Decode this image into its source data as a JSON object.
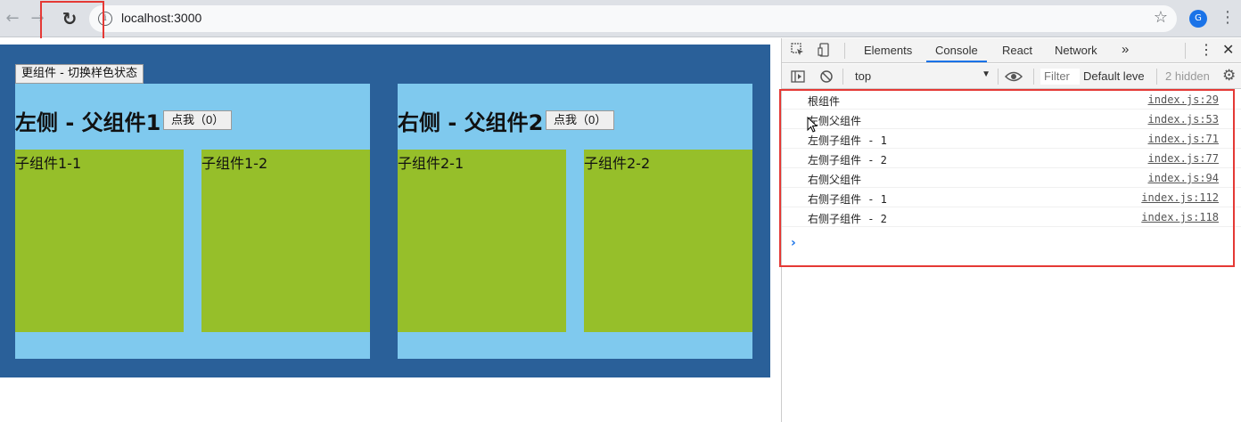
{
  "browser": {
    "url": "localhost:3000",
    "nav_back_icon": "←",
    "nav_forward_icon": "→",
    "reload_icon": "↻",
    "info_icon": "i",
    "star_icon": "☆",
    "profile_initial": "G",
    "menu_icon": "⋮"
  },
  "page": {
    "toggle_button": "更组件 - 切换样色状态",
    "left": {
      "title": "左侧 - 父组件1",
      "button": "点我（0）",
      "children": [
        "子组件1-1",
        "子组件1-2"
      ]
    },
    "right": {
      "title": "右侧 - 父组件2",
      "button": "点我（0）",
      "children": [
        "子组件2-1",
        "子组件2-2"
      ]
    },
    "colors": {
      "root": "#2a6099",
      "parent": "#7fc9ee",
      "child": "#96bf2a"
    }
  },
  "devtools": {
    "tabs": [
      "Elements",
      "Console",
      "React",
      "Network"
    ],
    "active_tab": "Console",
    "more_tabs_icon": "»",
    "context": "top",
    "filter_placeholder": "Filter",
    "levels": "Default leve",
    "hidden": "2 hidden",
    "logs": [
      {
        "msg": "根组件",
        "src": "index.js:29"
      },
      {
        "msg": "左侧父组件",
        "src": "index.js:53"
      },
      {
        "msg": "左侧子组件 - 1",
        "src": "index.js:71"
      },
      {
        "msg": "左侧子组件 - 2",
        "src": "index.js:77"
      },
      {
        "msg": "右侧父组件",
        "src": "index.js:94"
      },
      {
        "msg": "右侧子组件 - 1",
        "src": "index.js:112"
      },
      {
        "msg": "右侧子组件 - 2",
        "src": "index.js:118"
      }
    ],
    "prompt": "›"
  }
}
